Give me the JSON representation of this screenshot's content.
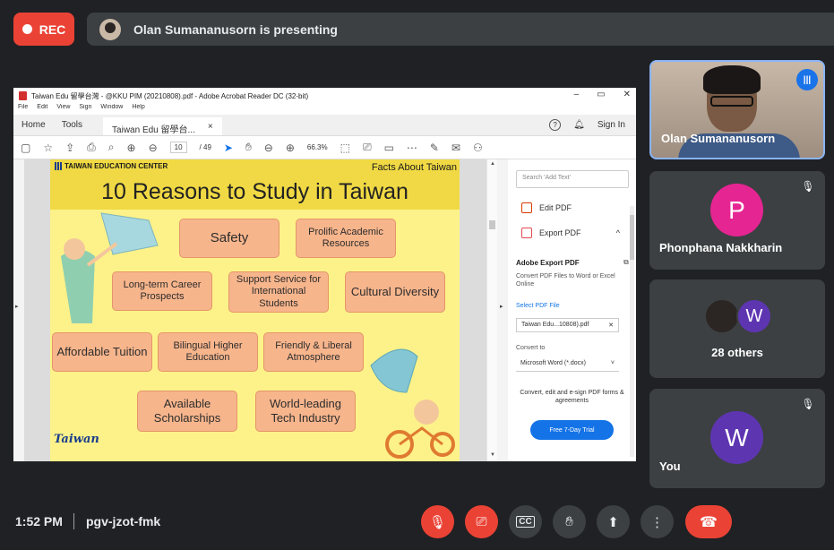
{
  "recording": {
    "label": "REC"
  },
  "presenting": {
    "text": "Olan Sumananusorn is presenting"
  },
  "acrobat": {
    "window_title": "Taiwan Edu 留學台灣 - @KKU PIM (20210808).pdf - Adobe Acrobat Reader DC (32-bit)",
    "menu": [
      "File",
      "Edit",
      "View",
      "Sign",
      "Window",
      "Help"
    ],
    "tabs": {
      "home": "Home",
      "tools": "Tools",
      "doc": "Taiwan Edu 留學台..."
    },
    "sign_in": "Sign In",
    "page_current": "10",
    "page_total": "/ 49",
    "zoom": "66.3%",
    "right_pane": {
      "search_placeholder": "Search 'Add Text'",
      "edit_pdf": "Edit PDF",
      "export_pdf": "Export PDF",
      "adobe_export_title": "Adobe Export PDF",
      "adobe_export_desc": "Convert PDF Files to Word or Excel Online",
      "select_pdf": "Select PDF File",
      "selected_file": "Taiwan Edu...10808).pdf",
      "convert_to": "Convert to",
      "format": "Microsoft Word (*.docx)",
      "promo": "Convert, edit and e-sign PDF forms & agreements",
      "trial_button": "Free 7-Day Trial"
    }
  },
  "poster": {
    "org": "TAIWAN EDUCATION CENTER",
    "facts": "Facts About Taiwan",
    "title": "10 Reasons to Study in Taiwan",
    "reasons": [
      "Safety",
      "Prolific Academic Resources",
      "Long-term Career Prospects",
      "Support Service for International Students",
      "Cultural Diversity",
      "Affordable Tuition",
      "Bilingual Higher Education",
      "Friendly & Liberal Atmosphere",
      "Available Scholarships",
      "World-leading Tech Industry"
    ],
    "logo": "Taiwan"
  },
  "participants": [
    {
      "name": "Olan Sumananusorn",
      "speaking": true
    },
    {
      "name": "Phonphana Nakkharin",
      "initial": "P",
      "color": "#e52592",
      "muted": true
    },
    {
      "name": "28 others",
      "initial": "W",
      "color": "#5e35b1"
    },
    {
      "name": "You",
      "initial": "W",
      "color": "#5e35b1",
      "muted": true
    }
  ],
  "footer": {
    "time": "1:52 PM",
    "meeting_code": "pgv-jzot-fmk"
  },
  "icons": {
    "mic_off": "mic-off-icon",
    "cam_off": "camera-off-icon",
    "captions": "captions-icon",
    "raise_hand": "raise-hand-icon",
    "present": "present-icon",
    "more": "more-vert-icon",
    "end_call": "end-call-icon"
  }
}
